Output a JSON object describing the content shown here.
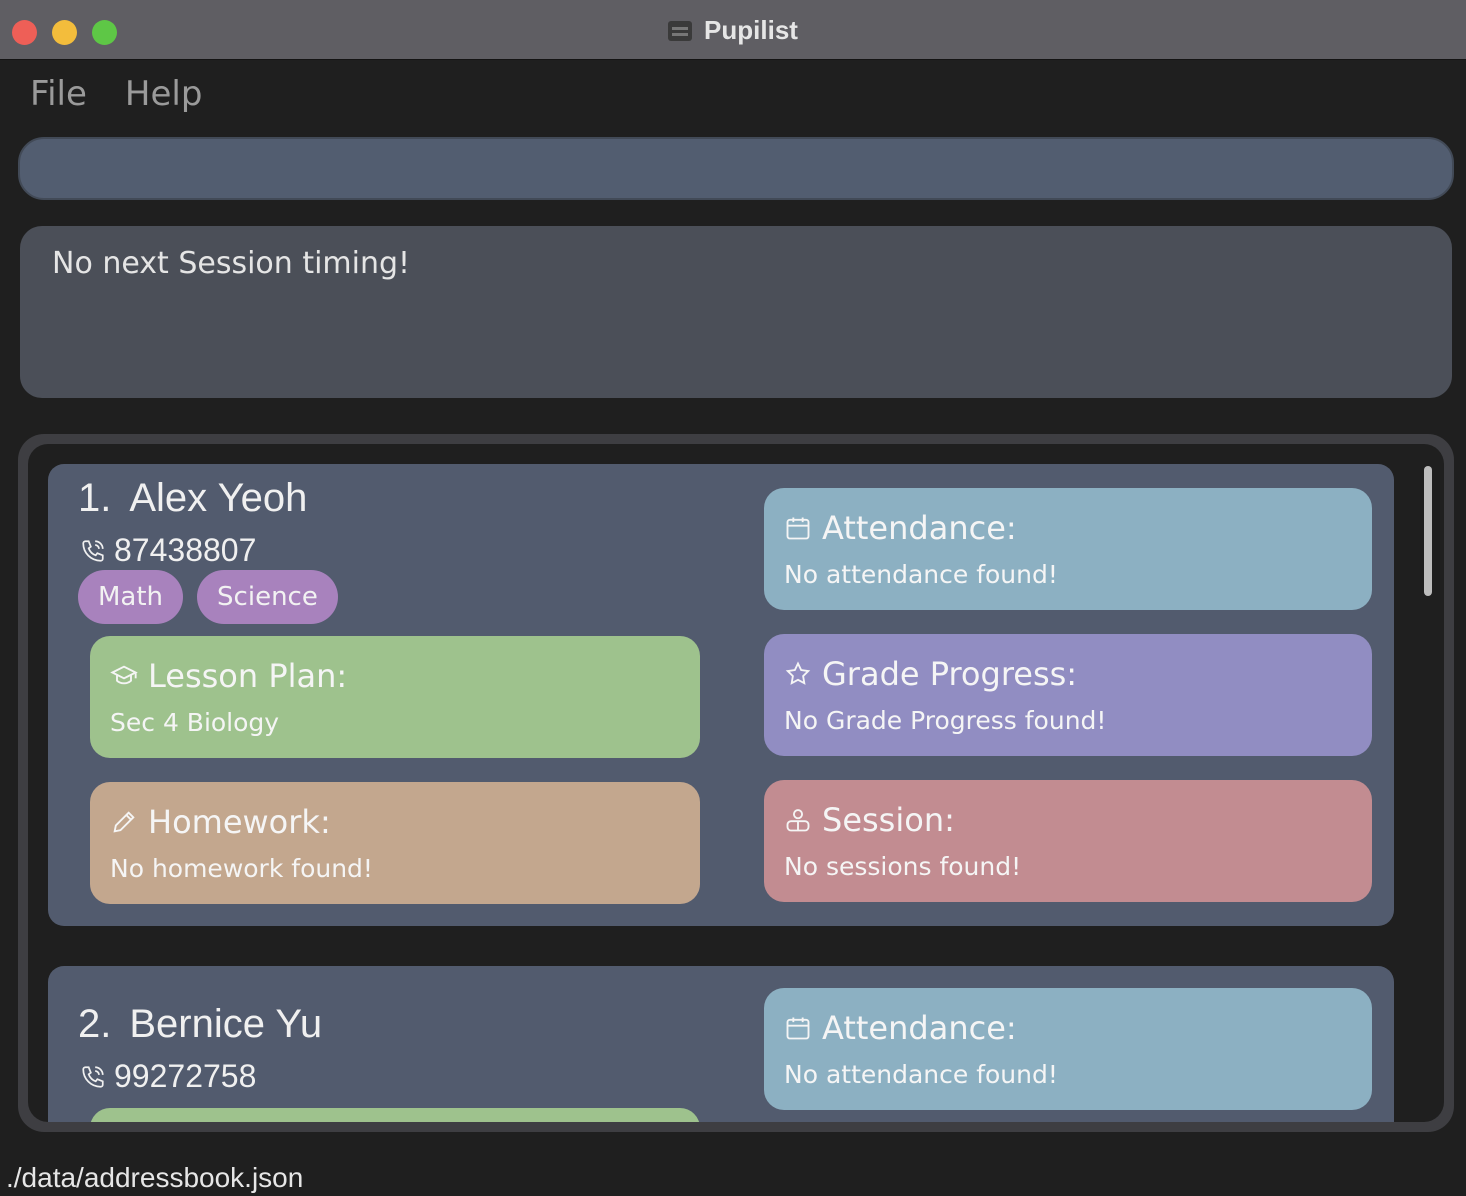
{
  "window": {
    "title": "Pupilist"
  },
  "menu": {
    "items": [
      "File",
      "Help"
    ]
  },
  "command_box": {
    "value": ""
  },
  "result_display": {
    "text": "No next Session timing!"
  },
  "persons": [
    {
      "index": "1.",
      "name": "Alex Yeoh",
      "phone": "87438807",
      "tags": [
        "Math",
        "Science"
      ],
      "lesson_plan": {
        "title": "Lesson Plan:",
        "value": "Sec 4 Biology"
      },
      "homework": {
        "title": "Homework:",
        "value": "No homework found!"
      },
      "attendance": {
        "title": "Attendance:",
        "value": "No attendance found!"
      },
      "grade_progress": {
        "title": "Grade Progress:",
        "value": "No Grade Progress found!"
      },
      "session": {
        "title": "Session:",
        "value": "No sessions found!"
      }
    },
    {
      "index": "2.",
      "name": "Bernice Yu",
      "phone": "99272758",
      "attendance": {
        "title": "Attendance:",
        "value": "No attendance found!"
      }
    }
  ],
  "status_bar": {
    "path": "./data/addressbook.json"
  },
  "colors": {
    "card": "#525b6e",
    "tag": "#a882bd",
    "lesson_plan": "#9ec28d",
    "homework": "#c3a78e",
    "attendance": "#8cb0c2",
    "grade_progress": "#918dc2",
    "session": "#c28c91"
  },
  "icons": {
    "phone": "phone-icon",
    "lesson_plan": "graduation-cap-icon",
    "homework": "pencil-icon",
    "attendance": "calendar-icon",
    "grade_progress": "star-icon",
    "session": "person-icon"
  }
}
